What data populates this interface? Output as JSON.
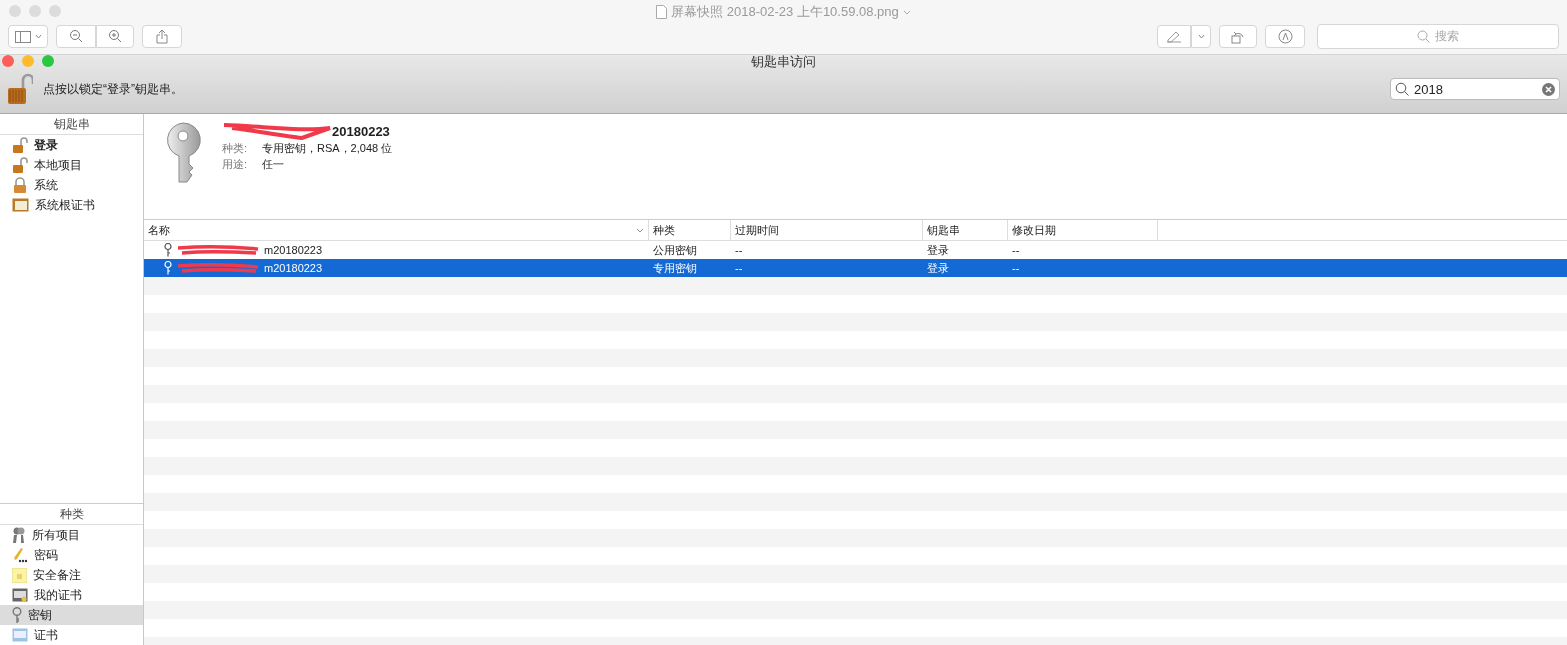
{
  "preview": {
    "title": "屏幕快照 2018-02-23 上午10.59.08.png",
    "search_placeholder": "搜索"
  },
  "keychain_window": {
    "title": "钥匙串访问",
    "lock_message": "点按以锁定“登录”钥匙串。",
    "search_value": "2018"
  },
  "sidebar": {
    "keychains_header": "钥匙串",
    "keychains": [
      {
        "label": "登录",
        "kind": "lock_open",
        "default": true
      },
      {
        "label": "本地项目",
        "kind": "lock_open",
        "default": false
      },
      {
        "label": "系统",
        "kind": "lock_closed",
        "default": false
      },
      {
        "label": "系统根证书",
        "kind": "cert_cabinet",
        "default": false
      }
    ],
    "categories_header": "种类",
    "categories": [
      {
        "label": "所有项目",
        "kind": "all",
        "selected": false
      },
      {
        "label": "密码",
        "kind": "password",
        "selected": false
      },
      {
        "label": "安全备注",
        "kind": "note",
        "selected": false
      },
      {
        "label": "我的证书",
        "kind": "my_cert",
        "selected": false
      },
      {
        "label": "密钥",
        "kind": "key",
        "selected": true
      },
      {
        "label": "证书",
        "kind": "cert",
        "selected": false
      }
    ]
  },
  "detail": {
    "title": "20180223",
    "fields": [
      {
        "label": "种类:",
        "value": "专用密钥，RSA，2,048 位"
      },
      {
        "label": "用途:",
        "value": "任一"
      }
    ]
  },
  "table": {
    "columns": [
      "名称",
      "种类",
      "过期时间",
      "钥匙串",
      "修改日期"
    ],
    "rows": [
      {
        "cells": [
          "m20180223",
          "公用密钥",
          "--",
          "登录",
          "--"
        ],
        "selected": false
      },
      {
        "cells": [
          "m20180223",
          "专用密钥",
          "--",
          "登录",
          "--"
        ],
        "selected": true
      }
    ]
  }
}
